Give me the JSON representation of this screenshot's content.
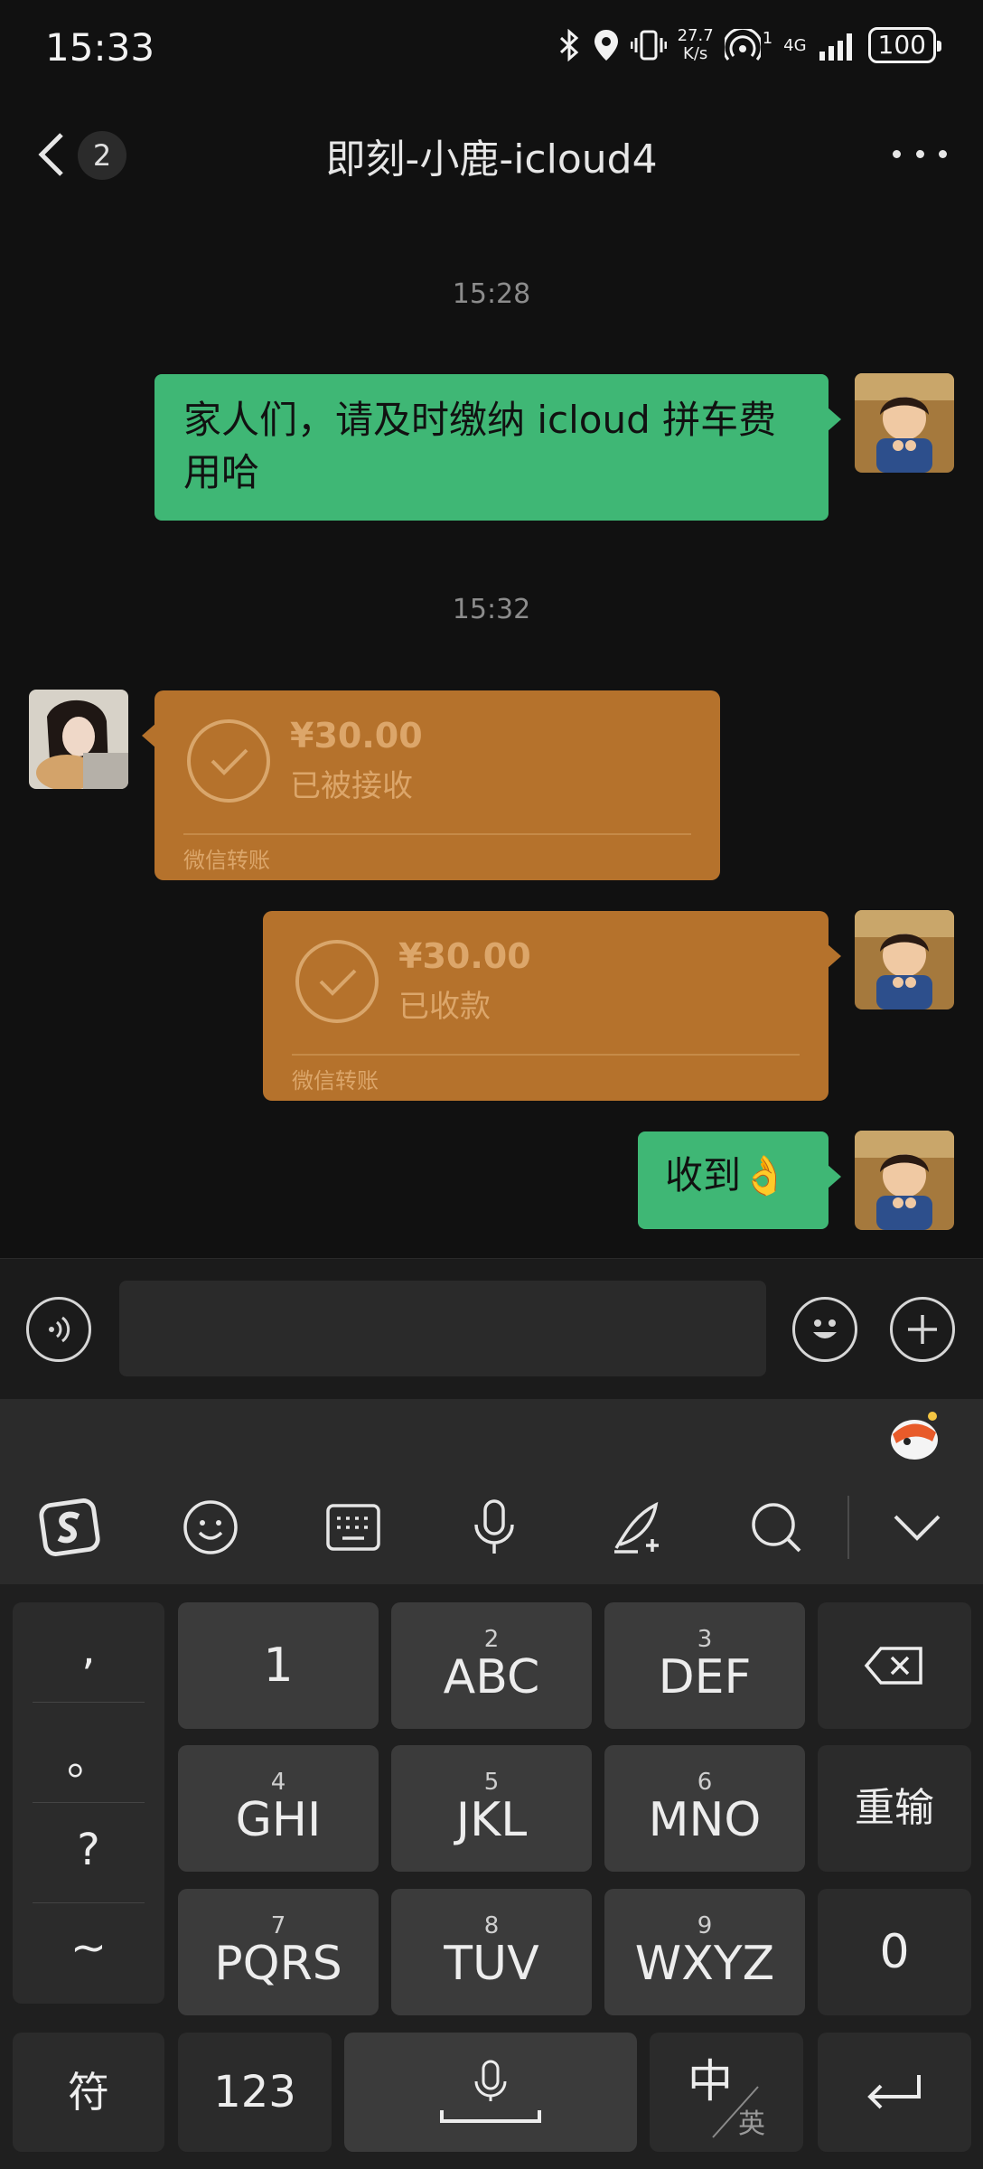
{
  "status": {
    "time": "15:33",
    "net_speed_top": "27.7",
    "net_speed_bottom": "K/s",
    "hotspot_count": "1",
    "network": "4G",
    "battery": "100"
  },
  "header": {
    "unread_count": "2",
    "title": "即刻-小鹿-icloud4"
  },
  "messages": {
    "time1": "15:28",
    "msg1": "家人们，请及时缴纳 icloud 拼车费用哈",
    "time2": "15:32",
    "transfer1": {
      "amount": "¥30.00",
      "status": "已被接收",
      "footer": "微信转账"
    },
    "transfer2": {
      "amount": "¥30.00",
      "status": "已收款",
      "footer": "微信转账"
    },
    "msg2": "收到👌"
  },
  "input": {
    "value": ""
  },
  "keyboard": {
    "punct": [
      ",",
      "。",
      "?",
      "~"
    ],
    "keys": [
      {
        "num": "",
        "label": "1"
      },
      {
        "num": "2",
        "label": "ABC"
      },
      {
        "num": "3",
        "label": "DEF"
      },
      {
        "num": "4",
        "label": "GHI"
      },
      {
        "num": "5",
        "label": "JKL"
      },
      {
        "num": "6",
        "label": "MNO"
      },
      {
        "num": "7",
        "label": "PQRS"
      },
      {
        "num": "8",
        "label": "TUV"
      },
      {
        "num": "9",
        "label": "WXYZ"
      }
    ],
    "reinput": "重输",
    "zero": "0",
    "symbol": "符",
    "numbers": "123",
    "lang_main": "中",
    "lang_alt": "英"
  },
  "colors": {
    "bubble_green": "#3fb775",
    "transfer_orange": "#b5722c",
    "background": "#111111"
  }
}
